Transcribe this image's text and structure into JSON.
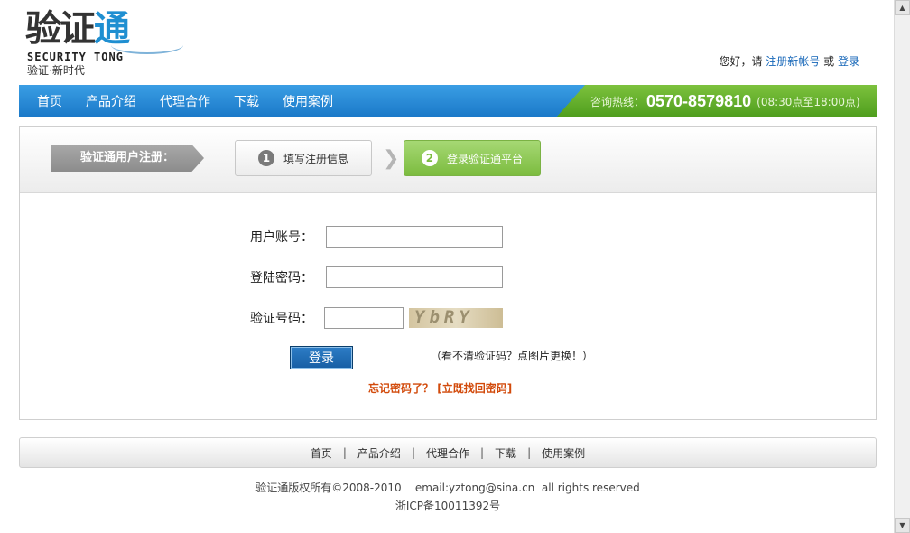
{
  "logo": {
    "main_left": "验证",
    "main_right": "通",
    "english": "SECURITY TONG",
    "tagline": "验证·新时代"
  },
  "welcome": {
    "greeting": "您好，请",
    "register_link": "注册新帐号",
    "or": "或",
    "login_link": "登录"
  },
  "nav": {
    "items": [
      "首页",
      "产品介绍",
      "代理合作",
      "下载",
      "使用案例"
    ],
    "hotline_label": "咨询热线：",
    "hotline_number": "0570-8579810",
    "hotline_hours": "(08:30点至18:00点)"
  },
  "steps": {
    "title": "验证通用户注册：",
    "step1_num": "1",
    "step1_label": "填写注册信息",
    "chevron": "❯",
    "step2_num": "2",
    "step2_label": "登录验证通平台"
  },
  "form": {
    "account_label": "用户账号：",
    "account_value": "",
    "password_label": "登陆密码：",
    "password_value": "",
    "captcha_label": "验证号码：",
    "captcha_value": "",
    "captcha_text": "YbRY",
    "login_button": "登录",
    "captcha_hint": "（看不清验证码？点图片更换！）",
    "forgot_text": "忘记密码了？",
    "forgot_link": "[立既找回密码]"
  },
  "footer": {
    "links": [
      "首页",
      "产品介绍",
      "代理合作",
      "下载",
      "使用案例"
    ],
    "separator": "|",
    "copyright": "验证通版权所有©2008-2010    email:yztong@sina.cn  all rights reserved",
    "icp": "浙ICP备10011392号"
  },
  "colors": {
    "nav_blue": "#1a78c8",
    "hotline_green": "#5ea82a",
    "step_active_green": "#7cbc3f",
    "link_blue": "#1566b8",
    "forgot_orange": "#d24a0b"
  }
}
